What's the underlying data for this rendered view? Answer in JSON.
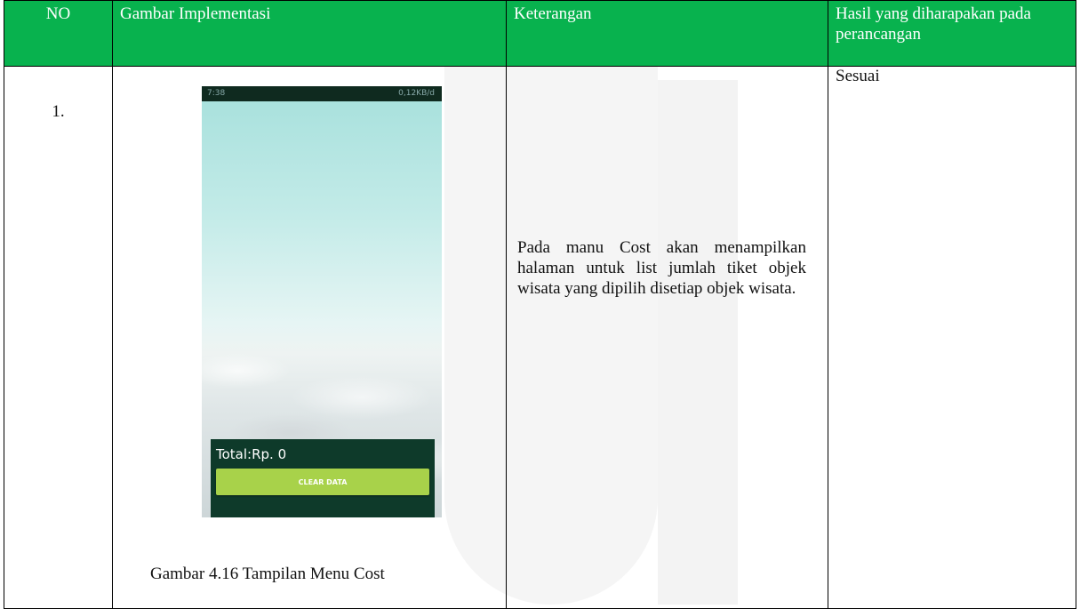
{
  "table": {
    "headers": {
      "no": "NO",
      "gambar": "Gambar Implementasi",
      "keterangan": "Keterangan",
      "hasil": "Hasil yang diharapakan pada perancangan"
    },
    "rows": [
      {
        "no": "1.",
        "phone": {
          "status_left": "7:38",
          "status_right": "0,12KB/d",
          "total_label": "Total:Rp. 0",
          "clear_button": "CLEAR DATA"
        },
        "caption": "Gambar 4.16 Tampilan Menu Cost",
        "keterangan": "Pada manu Cost akan menampilkan halaman untuk list jumlah tiket objek wisata yang dipilih disetiap objek wisata.",
        "hasil": "Sesuai"
      }
    ]
  },
  "colors": {
    "header_bg": "#08b24e",
    "header_text": "#ffffff",
    "button": "#a8d24a",
    "total_bar": "#0e3a2a"
  }
}
